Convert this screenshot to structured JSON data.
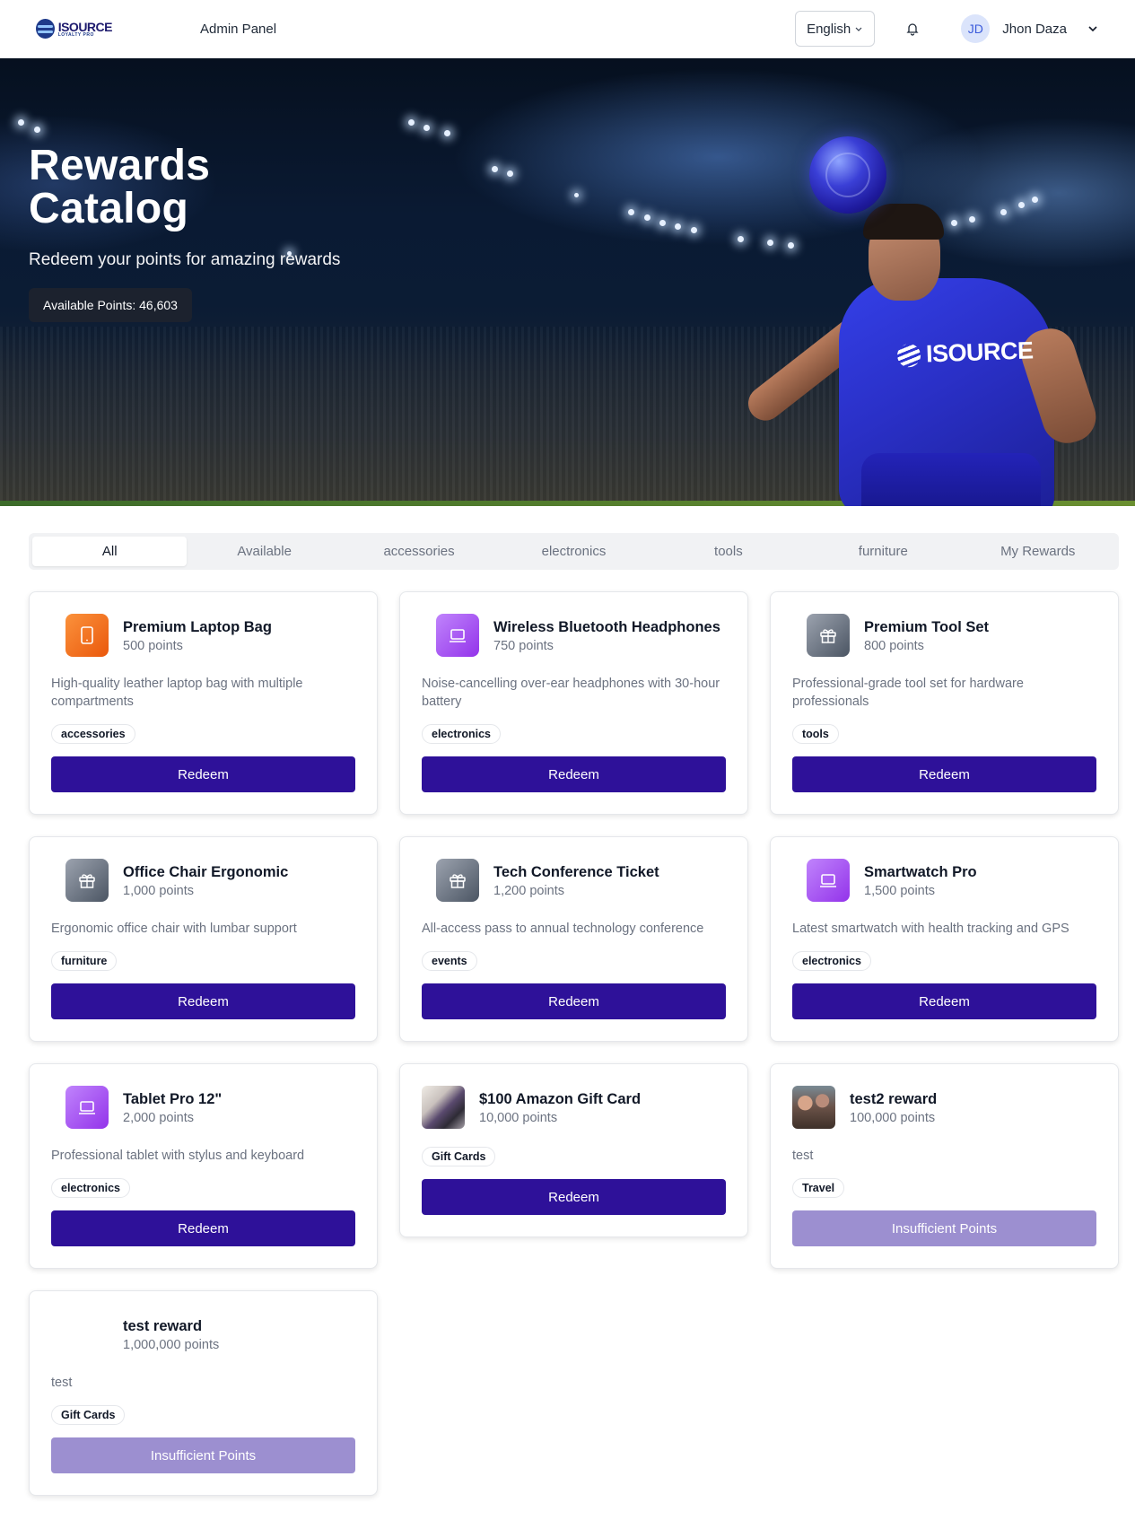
{
  "header": {
    "logo_text": "ISOURCE",
    "logo_sub": "LOYALTY PRO",
    "admin_link": "Admin Panel",
    "language": "English",
    "user_initials": "JD",
    "user_name": "Jhon Daza"
  },
  "hero": {
    "title": "Rewards Catalog",
    "subtitle": "Redeem your points for amazing rewards",
    "points_label": "Available Points: 46,603",
    "jersey_text": "ISOURCE"
  },
  "tabs": [
    {
      "label": "All",
      "active": true
    },
    {
      "label": "Available"
    },
    {
      "label": "accessories"
    },
    {
      "label": "electronics"
    },
    {
      "label": "tools"
    },
    {
      "label": "furniture"
    },
    {
      "label": "My Rewards"
    }
  ],
  "rewards": [
    {
      "title": "Premium Laptop Bag",
      "points": "500 points",
      "description": "High-quality leather laptop bag with multiple compartments",
      "category": "accessories",
      "button": "Redeem",
      "icon": "tablet-icon",
      "icon_color": "#f97316"
    },
    {
      "title": "Wireless Bluetooth Headphones",
      "points": "750 points",
      "description": "Noise-cancelling over-ear headphones with 30-hour battery",
      "category": "electronics",
      "button": "Redeem",
      "icon": "laptop-icon",
      "icon_color": "#a855f7"
    },
    {
      "title": "Premium Tool Set",
      "points": "800 points",
      "description": "Professional-grade tool set for hardware professionals",
      "category": "tools",
      "button": "Redeem",
      "icon": "gift-icon",
      "icon_color": "#6b7280"
    },
    {
      "title": "Office Chair Ergonomic",
      "points": "1,000 points",
      "description": "Ergonomic office chair with lumbar support",
      "category": "furniture",
      "button": "Redeem",
      "icon": "gift-icon",
      "icon_color": "#6b7280"
    },
    {
      "title": "Tech Conference Ticket",
      "points": "1,200 points",
      "description": "All-access pass to annual technology conference",
      "category": "events",
      "button": "Redeem",
      "icon": "gift-icon",
      "icon_color": "#6b7280"
    },
    {
      "title": "Smartwatch Pro",
      "points": "1,500 points",
      "description": "Latest smartwatch with health tracking and GPS",
      "category": "electronics",
      "button": "Redeem",
      "icon": "laptop-icon",
      "icon_color": "#a855f7"
    },
    {
      "title": "Tablet Pro 12\"",
      "points": "2,000 points",
      "description": "Professional tablet with stylus and keyboard",
      "category": "electronics",
      "button": "Redeem",
      "icon": "laptop-icon",
      "icon_color": "#a855f7"
    },
    {
      "title": "$100 Amazon Gift Card",
      "points": "10,000 points",
      "description": "",
      "category": "Gift Cards",
      "button": "Redeem",
      "icon": "product-photo",
      "icon_color": ""
    },
    {
      "title": "test2 reward",
      "points": "100,000 points",
      "description": "test",
      "category": "Travel",
      "button": "Insufficient Points",
      "icon": "people-photo",
      "icon_color": ""
    },
    {
      "title": "test reward",
      "points": "1,000,000 points",
      "description": "test",
      "category": "Gift Cards",
      "button": "Insufficient Points",
      "icon": "none",
      "icon_color": ""
    }
  ],
  "colors": {
    "primary_button": "#2e1199",
    "disabled_button": "#9c8fd0"
  }
}
